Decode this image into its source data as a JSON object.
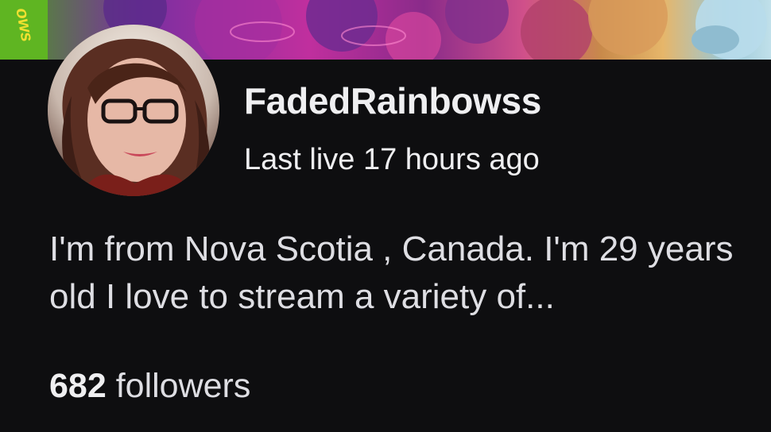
{
  "profile": {
    "display_name": "FadedRainbowss",
    "last_live": "Last live 17 hours ago",
    "bio": "I'm from Nova Scotia , Canada. I'm 29 years old I love to stream a variety of...",
    "follower_count": "682",
    "follower_label": "followers",
    "avatar_icon": "streamer-avatar-photo",
    "banner_icon": "profile-banner-art",
    "banner_logo_text": "ows"
  },
  "colors": {
    "background": "#0e0e10",
    "text_primary": "#efeff1",
    "text_secondary": "#dedee3"
  }
}
